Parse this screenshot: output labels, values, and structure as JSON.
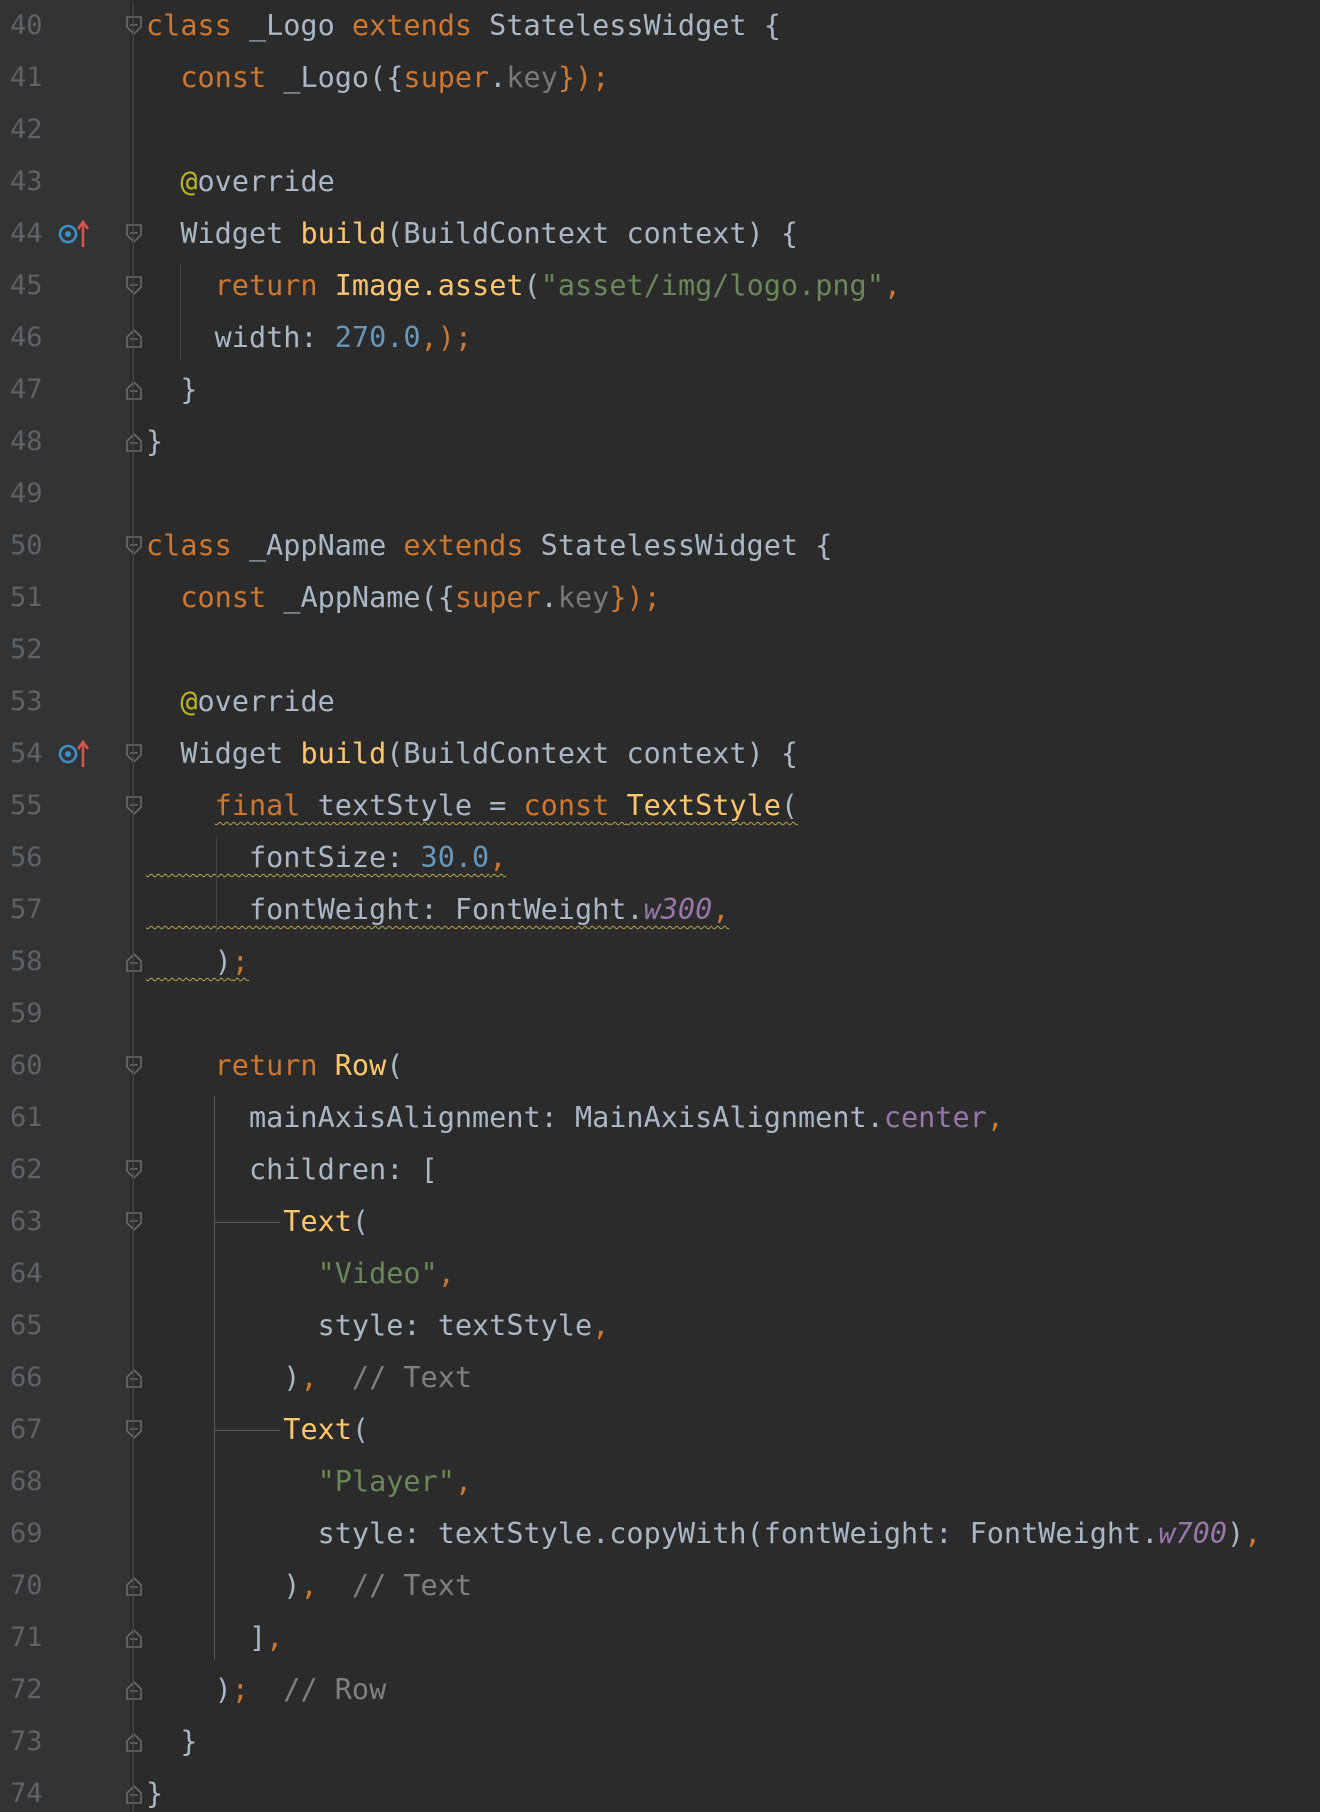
{
  "editor": {
    "lines": [
      {
        "n": "40",
        "seg": [
          "class",
          " _Logo ",
          "extends",
          " StatelessWidget {"
        ]
      },
      {
        "n": "41",
        "seg": [
          "  ",
          "const",
          " _Logo({",
          "super",
          ".",
          "key",
          "});"
        ]
      },
      {
        "n": "42",
        "seg": []
      },
      {
        "n": "43",
        "seg": [
          "  ",
          "@",
          "override"
        ]
      },
      {
        "n": "44",
        "seg": [
          "  Widget ",
          "build",
          "(BuildContext context) {"
        ]
      },
      {
        "n": "45",
        "seg": [
          "    ",
          "return",
          " ",
          "Image.asset",
          "(",
          "\"asset/img/logo.png\"",
          ","
        ]
      },
      {
        "n": "46",
        "seg": [
          "    width: ",
          "270.0",
          ",);"
        ]
      },
      {
        "n": "47",
        "seg": [
          "  }"
        ]
      },
      {
        "n": "48",
        "seg": [
          "}"
        ]
      },
      {
        "n": "49",
        "seg": []
      },
      {
        "n": "50",
        "seg": [
          "class",
          " _AppName ",
          "extends",
          " StatelessWidget {"
        ]
      },
      {
        "n": "51",
        "seg": [
          "  ",
          "const",
          " _AppName({",
          "super",
          ".",
          "key",
          "});"
        ]
      },
      {
        "n": "52",
        "seg": []
      },
      {
        "n": "53",
        "seg": [
          "  ",
          "@",
          "override"
        ]
      },
      {
        "n": "54",
        "seg": [
          "  Widget ",
          "build",
          "(BuildContext context) {"
        ]
      },
      {
        "n": "55",
        "seg": [
          "    ",
          "final",
          " textStyle = ",
          "const",
          " ",
          "TextStyle",
          "("
        ]
      },
      {
        "n": "56",
        "seg": [
          "      fontSize: ",
          "30.0",
          ","
        ]
      },
      {
        "n": "57",
        "seg": [
          "      fontWeight: FontWeight.",
          "w300",
          ","
        ]
      },
      {
        "n": "58",
        "seg": [
          "    )",
          ";"
        ]
      },
      {
        "n": "59",
        "seg": []
      },
      {
        "n": "60",
        "seg": [
          "    ",
          "return",
          " ",
          "Row",
          "("
        ]
      },
      {
        "n": "61",
        "seg": [
          "      mainAxisAlignment: MainAxisAlignment.",
          "center",
          ","
        ]
      },
      {
        "n": "62",
        "seg": [
          "      children: ["
        ]
      },
      {
        "n": "63",
        "seg": [
          "        ",
          "Text",
          "("
        ]
      },
      {
        "n": "64",
        "seg": [
          "          ",
          "\"Video\"",
          ","
        ]
      },
      {
        "n": "65",
        "seg": [
          "          style: textStyle",
          ","
        ]
      },
      {
        "n": "66",
        "seg": [
          "        )",
          ",",
          "  // Text"
        ]
      },
      {
        "n": "67",
        "seg": [
          "        ",
          "Text",
          "("
        ]
      },
      {
        "n": "68",
        "seg": [
          "          ",
          "\"Player\"",
          ","
        ]
      },
      {
        "n": "69",
        "seg": [
          "          style: textStyle.copyWith(fontWeight: FontWeight.",
          "w700",
          ")",
          ","
        ]
      },
      {
        "n": "70",
        "seg": [
          "        )",
          ",",
          "  // Text"
        ]
      },
      {
        "n": "71",
        "seg": [
          "      ]",
          ","
        ]
      },
      {
        "n": "72",
        "seg": [
          "    )",
          ";",
          "  // Row"
        ]
      },
      {
        "n": "73",
        "seg": [
          "  }"
        ]
      },
      {
        "n": "74",
        "seg": [
          "}"
        ]
      }
    ],
    "gutter_icons": {
      "44": "override-marker-icon",
      "54": "override-marker-icon"
    },
    "colors": {
      "background": "#2b2b2b",
      "gutter": "#313335",
      "keyword": "#cc7832",
      "type_call": "#ffc66d",
      "string": "#6a8759",
      "number": "#6897bb",
      "annotation": "#bbb529",
      "comment": "#808080",
      "enum_value": "#9876aa",
      "default_text": "#a9b7c6"
    }
  }
}
